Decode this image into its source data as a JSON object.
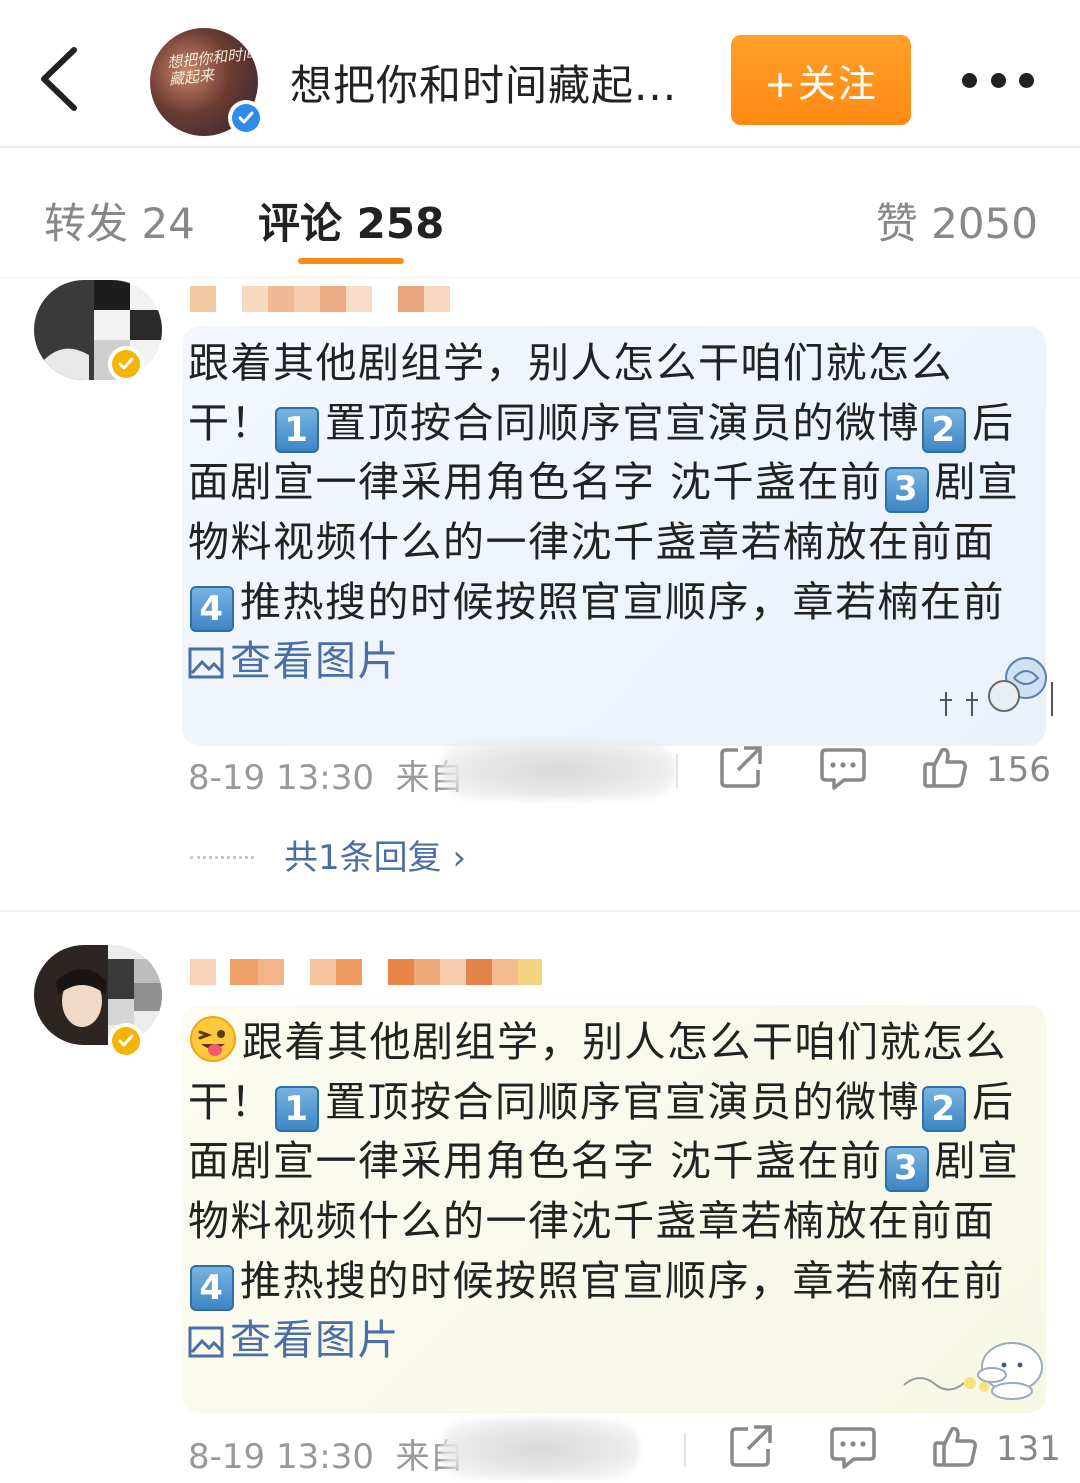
{
  "header": {
    "title": "想把你和时间藏起...",
    "avatar_text": "想把你和时间藏起来",
    "follow_label": "+关注"
  },
  "tabs": {
    "repost": "转发 24",
    "comments": "评论 258",
    "likes": "赞 2050"
  },
  "colors": {
    "accent": "#ff8a14",
    "link": "#4a6fa5",
    "verified_blue": "#2f8be6",
    "verified_gold": "#f5b400"
  },
  "comments": [
    {
      "text_parts": {
        "p1": "跟着其他剧组学，别人怎么干咱们就怎么干！",
        "k1": "1",
        "p2": "置顶按合同顺序官宣演员的微博",
        "k2": "2",
        "p3": "后面剧宣一律采用角色名字 沈千盏在前",
        "k3": "3",
        "p4": "剧宣物料视频什么的一律沈千盏章若楠放在前面",
        "k4": "4",
        "p5": "推热搜的时候按照官宣顺序，章若楠在前"
      },
      "view_pic": "查看图片",
      "time": "8-19 13:30",
      "source_prefix": "来自",
      "likes": "156",
      "reply_summary": "共1条回复 ›"
    },
    {
      "text_parts": {
        "p1": "跟着其他剧组学，别人怎么干咱们就怎么干！",
        "k1": "1",
        "p2": "置顶按合同顺序官宣演员的微博",
        "k2": "2",
        "p3": "后面剧宣一律采用角色名字 沈千盏在前",
        "k3": "3",
        "p4": "剧宣物料视频什么的一律沈千盏章若楠放在前面",
        "k4": "4",
        "p5": "推热搜的时候按照官宣顺序，章若楠在前"
      },
      "view_pic": "查看图片",
      "time": "8-19 13:30",
      "source_prefix": "来自",
      "likes": "131"
    }
  ]
}
